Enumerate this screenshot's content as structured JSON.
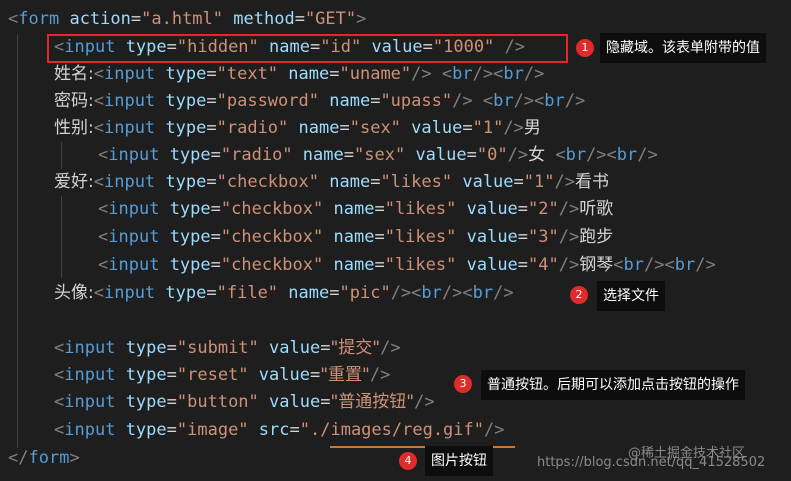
{
  "code": {
    "form_open": {
      "tag": "form",
      "action_attr": "action",
      "action_val": "\"a.html\"",
      "method_attr": "method",
      "method_val": "\"GET\""
    },
    "hidden": {
      "tag": "input",
      "type_attr": "type",
      "type_val": "\"hidden\"",
      "name_attr": "name",
      "name_val": "\"id\"",
      "value_attr": "value",
      "value_val": "\"1000\""
    },
    "uname": {
      "label": "姓名:",
      "tag": "input",
      "type_attr": "type",
      "type_val": "\"text\"",
      "name_attr": "name",
      "name_val": "\"uname\""
    },
    "upass": {
      "label": "密码:",
      "tag": "input",
      "type_attr": "type",
      "type_val": "\"password\"",
      "name_attr": "name",
      "name_val": "\"upass\""
    },
    "sex1": {
      "label": "性别:",
      "tag": "input",
      "type_attr": "type",
      "type_val": "\"radio\"",
      "name_attr": "name",
      "name_val": "\"sex\"",
      "value_attr": "value",
      "value_val": "\"1\"",
      "text": "男"
    },
    "sex0": {
      "tag": "input",
      "type_attr": "type",
      "type_val": "\"radio\"",
      "name_attr": "name",
      "name_val": "\"sex\"",
      "value_attr": "value",
      "value_val": "\"0\"",
      "text": "女"
    },
    "likes1": {
      "label": "爱好:",
      "tag": "input",
      "type_attr": "type",
      "type_val": "\"checkbox\"",
      "name_attr": "name",
      "name_val": "\"likes\"",
      "value_attr": "value",
      "value_val": "\"1\"",
      "text": "看书"
    },
    "likes2": {
      "tag": "input",
      "type_attr": "type",
      "type_val": "\"checkbox\"",
      "name_attr": "name",
      "name_val": "\"likes\"",
      "value_attr": "value",
      "value_val": "\"2\"",
      "text": "听歌"
    },
    "likes3": {
      "tag": "input",
      "type_attr": "type",
      "type_val": "\"checkbox\"",
      "name_attr": "name",
      "name_val": "\"likes\"",
      "value_attr": "value",
      "value_val": "\"3\"",
      "text": "跑步"
    },
    "likes4": {
      "tag": "input",
      "type_attr": "type",
      "type_val": "\"checkbox\"",
      "name_attr": "name",
      "name_val": "\"likes\"",
      "value_attr": "value",
      "value_val": "\"4\"",
      "text": "钢琴"
    },
    "pic": {
      "label": "头像:",
      "tag": "input",
      "type_attr": "type",
      "type_val": "\"file\"",
      "name_attr": "name",
      "name_val": "\"pic\""
    },
    "submit": {
      "tag": "input",
      "type_attr": "type",
      "type_val": "\"submit\"",
      "value_attr": "value",
      "value_val": "\"提交\""
    },
    "reset": {
      "tag": "input",
      "type_attr": "type",
      "type_val": "\"reset\"",
      "value_attr": "value",
      "value_val": "\"重置\""
    },
    "button": {
      "tag": "input",
      "type_attr": "type",
      "type_val": "\"button\"",
      "value_attr": "value",
      "value_val": "\"普通按钮\""
    },
    "image": {
      "tag": "input",
      "type_attr": "type",
      "type_val": "\"image\"",
      "src_attr": "src",
      "src_val": "\"./images/reg.gif\""
    },
    "form_close": {
      "tag": "form"
    },
    "br": "br",
    "open": "<",
    "close": ">",
    "self_close": "/>",
    "end_open": "</",
    "eq": "="
  },
  "annotations": [
    {
      "number": "1",
      "text": "隐藏域。该表单附带的值"
    },
    {
      "number": "2",
      "text": "选择文件"
    },
    {
      "number": "3",
      "text": "普通按钮。后期可以添加点击按钮的操作"
    },
    {
      "number": "4",
      "text": "图片按钮"
    }
  ],
  "watermark": {
    "url": "https://blog.csdn.net/qq_41528502",
    "brand": "@稀土掘金技术社区"
  },
  "colors": {
    "background": "#1e1e1e",
    "tag": "#569cd6",
    "attribute": "#9cdcfe",
    "string": "#ce9178",
    "text": "#d4d4d4",
    "highlight_box": "#e5252a",
    "badge": "#e02b2b"
  }
}
